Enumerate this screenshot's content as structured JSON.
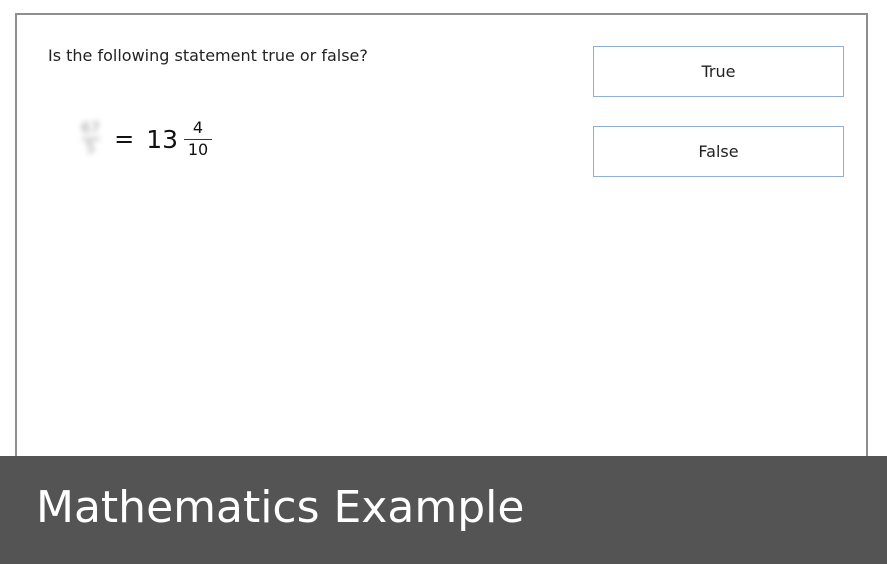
{
  "question": {
    "prompt": "Is the following statement true or false?",
    "equation": {
      "left_numerator": "67",
      "left_denominator": "5",
      "equals": "=",
      "whole": "13",
      "numerator": "4",
      "denominator": "10"
    }
  },
  "options": [
    {
      "label": "True"
    },
    {
      "label": "False"
    }
  ],
  "banner": {
    "title": "Mathematics Example",
    "background_color": "#545454"
  },
  "colors": {
    "option_border": "#8fb0cf",
    "card_border": "#8e8e8e"
  }
}
